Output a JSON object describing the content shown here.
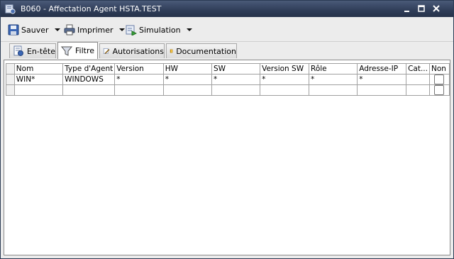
{
  "window": {
    "title": "B060 - Affectation Agent HSTA.TEST"
  },
  "toolbar": {
    "save_label": "Sauver",
    "print_label": "Imprimer",
    "simulation_label": "Simulation"
  },
  "tabs": [
    {
      "label": "En-tête",
      "icon": "header-doc-icon"
    },
    {
      "label": "Filtre",
      "icon": "funnel-icon",
      "active": true
    },
    {
      "label": "Autorisations",
      "icon": "pencil-doc-icon"
    },
    {
      "label": "Documentation",
      "icon": "book-icon"
    }
  ],
  "grid": {
    "columns": [
      "Nom",
      "Type d'Agent",
      "Version",
      "HW",
      "SW",
      "Version SW",
      "Rôle",
      "Adresse-IP",
      "Cat...",
      "Non"
    ],
    "rows": [
      {
        "cells": [
          "WIN*",
          "WINDOWS",
          "*",
          "*",
          "*",
          "*",
          "*",
          "*",
          ""
        ],
        "non": false
      },
      {
        "cells": [
          "",
          "",
          "",
          "",
          "",
          "",
          "",
          "",
          ""
        ],
        "non": false
      }
    ]
  }
}
